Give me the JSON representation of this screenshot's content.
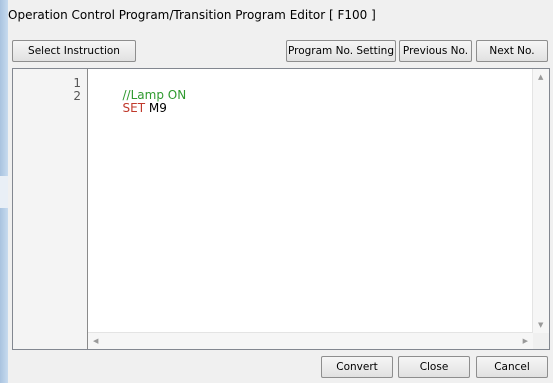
{
  "window": {
    "title": "Operation Control Program/Transition Program Editor [ F100 ]"
  },
  "toolbar": {
    "select_instruction_label": "Select Instruction",
    "program_no_setting_label": "Program No. Setting",
    "previous_no_label": "Previous No.",
    "next_no_label": "Next No."
  },
  "editor": {
    "lines": [
      {
        "number": "1",
        "segments": [
          {
            "text": "//Lamp ON",
            "kind": "comment"
          }
        ]
      },
      {
        "number": "2",
        "segments": [
          {
            "text": "SET",
            "kind": "keyword"
          },
          {
            "text": " M9",
            "kind": "text"
          }
        ]
      }
    ],
    "colors": {
      "comment": "#2f9a2f",
      "keyword": "#c0392b",
      "text": "#000000"
    }
  },
  "footer": {
    "convert_label": "Convert",
    "close_label": "Close",
    "cancel_label": "Cancel"
  },
  "icons": [
    "scroll-up-arrow-icon",
    "scroll-down-arrow-icon",
    "scroll-left-arrow-icon",
    "scroll-right-arrow-icon"
  ]
}
